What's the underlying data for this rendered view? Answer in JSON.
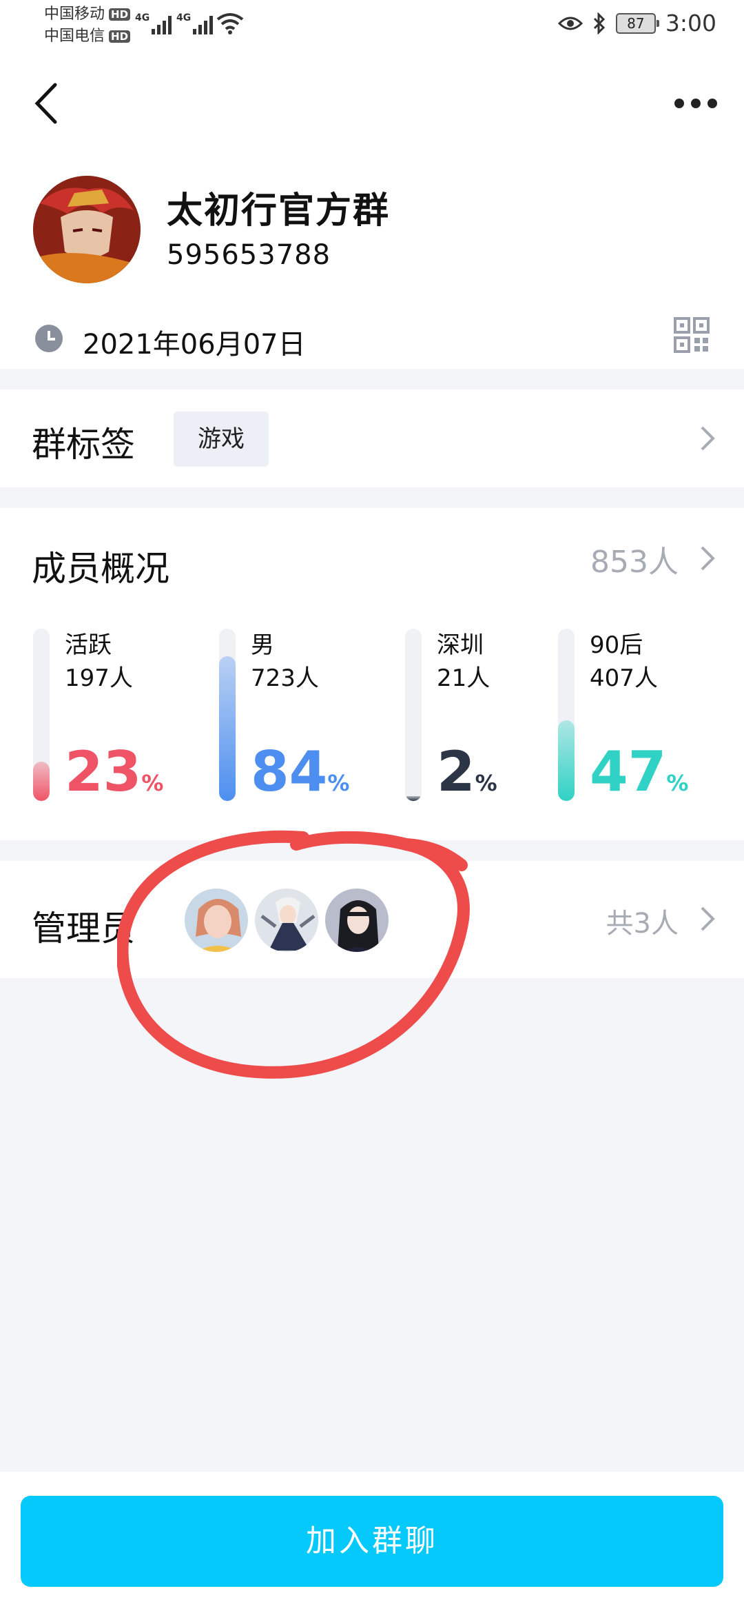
{
  "status_bar": {
    "carrier1": "中国移动",
    "carrier2": "中国电信",
    "hd": "HD",
    "net1": "4G",
    "net2": "4G",
    "battery": "87",
    "time": "3:00"
  },
  "header": {
    "group_name": "太初行官方群",
    "group_id": "595653788",
    "created_date": "2021年06月07日"
  },
  "tag_section": {
    "title": "群标签",
    "tag": "游戏"
  },
  "members": {
    "title": "成员概况",
    "count": "853人",
    "stats": [
      {
        "label": "活跃",
        "count": "197人",
        "percent": "23",
        "color": "#ef5466"
      },
      {
        "label": "男",
        "count": "723人",
        "percent": "84",
        "color": "#4d8ff0"
      },
      {
        "label": "深圳",
        "count": "21人",
        "percent": "2",
        "color": "#2c3546"
      },
      {
        "label": "90后",
        "count": "407人",
        "percent": "47",
        "color": "#2fd2c4"
      }
    ],
    "percent_sign": "%"
  },
  "admins": {
    "title": "管理员",
    "total": "共3人"
  },
  "join_button": "加入群聊",
  "colors": {
    "accent": "#05c8fb",
    "annotation": "#ee4b4b"
  }
}
